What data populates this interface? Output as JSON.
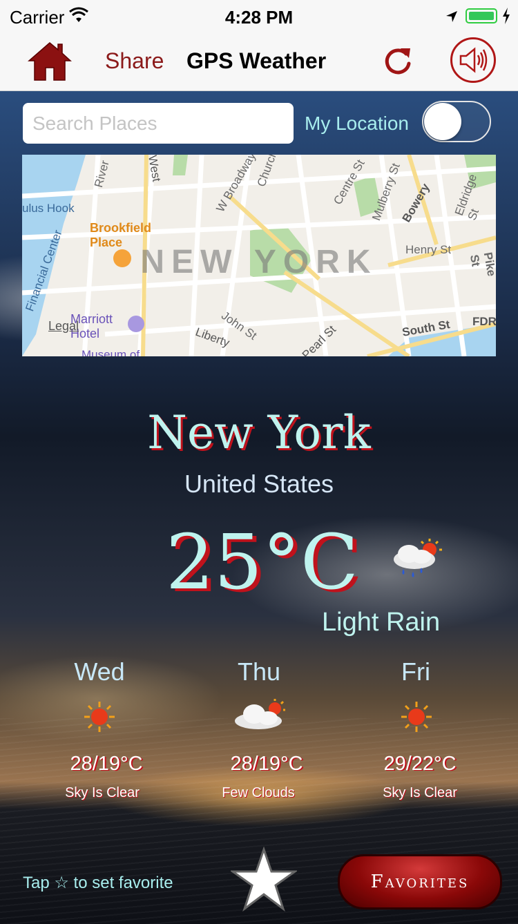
{
  "status_bar": {
    "carrier": "Carrier",
    "time": "4:28 PM"
  },
  "nav": {
    "share_label": "Share",
    "title": "GPS Weather"
  },
  "search": {
    "placeholder": "Search Places",
    "value": ""
  },
  "location_toggle": {
    "label": "My Location",
    "on": false
  },
  "map": {
    "city_label": "NEW YORK",
    "labels": [
      "Brookfield Place",
      "Marriott Hotel",
      "Museum of",
      "W Broadway",
      "Church",
      "Centre St",
      "Mulberry St",
      "Bowery",
      "Eldridge St",
      "Henry St",
      "Pike St",
      "South St",
      "FDR",
      "Pearl St",
      "John St",
      "Liberty",
      "West",
      "River",
      "ulus Hook",
      "Financial Center"
    ],
    "legal": "Legal"
  },
  "weather": {
    "city": "New York",
    "country": "United States",
    "temperature": "25°C",
    "condition": "Light Rain",
    "condition_icon": "rain-cloud-sun-icon"
  },
  "forecast": [
    {
      "day": "Wed",
      "temp": "28/19°C",
      "desc": "Sky Is Clear",
      "icon": "sun-icon"
    },
    {
      "day": "Thu",
      "temp": "28/19°C",
      "desc": "Few Clouds",
      "icon": "cloud-sun-icon"
    },
    {
      "day": "Fri",
      "temp": "29/22°C",
      "desc": "Sky Is Clear",
      "icon": "sun-icon"
    }
  ],
  "footer": {
    "hint": "Tap ☆ to set favorite",
    "favorites_label": "Favorites"
  },
  "colors": {
    "accent_red": "#b01717",
    "text_cyan": "#bff3ee",
    "shadow_red": "#c0121c"
  }
}
